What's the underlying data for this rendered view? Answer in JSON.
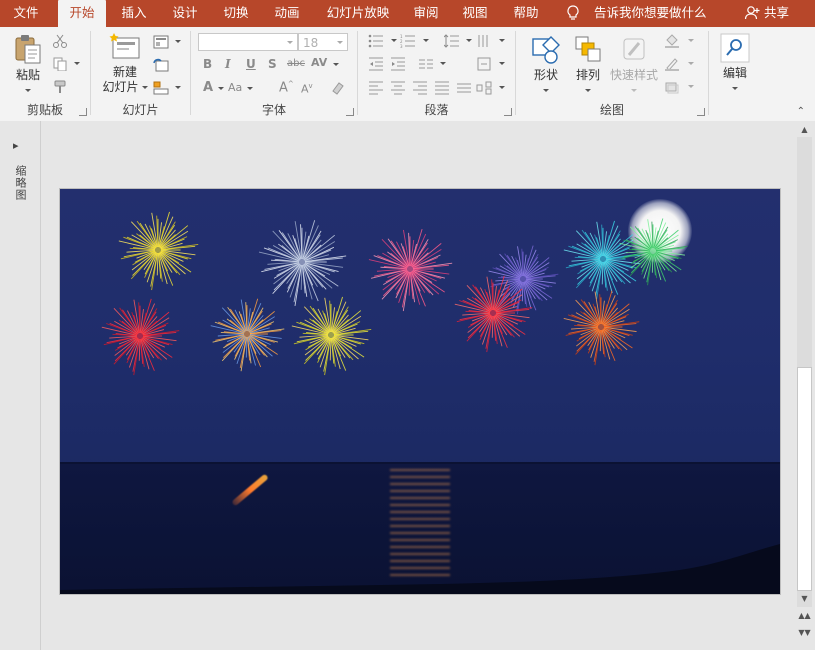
{
  "menu": {
    "tabs": [
      {
        "label": "文件"
      },
      {
        "label": "开始",
        "active": true
      },
      {
        "label": "插入"
      },
      {
        "label": "设计"
      },
      {
        "label": "切换"
      },
      {
        "label": "动画"
      },
      {
        "label": "幻灯片放映"
      },
      {
        "label": "审阅"
      },
      {
        "label": "视图"
      },
      {
        "label": "帮助"
      }
    ],
    "tell_me": "告诉我你想要做什么",
    "share": "共享"
  },
  "ribbon": {
    "clipboard": {
      "label": "剪贴板",
      "paste": "粘贴"
    },
    "slides": {
      "label": "幻灯片",
      "new_slide_line1": "新建",
      "new_slide_line2": "幻灯片"
    },
    "font": {
      "label": "字体",
      "font_size": "18"
    },
    "paragraph": {
      "label": "段落"
    },
    "drawing": {
      "label": "绘图",
      "shapes": "形状",
      "arrange": "排列",
      "quick_styles": "快速样式"
    },
    "editing": {
      "label": "编辑"
    }
  },
  "left_pane": {
    "label": "缩略图"
  },
  "colors": {
    "accent": "#b7472a",
    "ribbon_bg": "#f3f3f3",
    "canvas_bg": "#e6e6e6"
  }
}
